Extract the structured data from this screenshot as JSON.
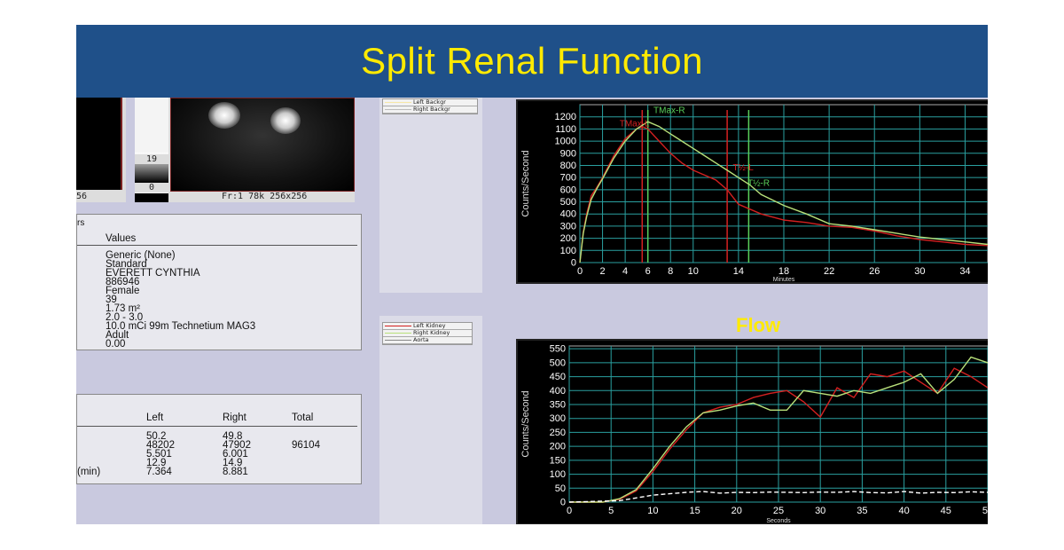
{
  "slide": {
    "title": "Split Renal Function"
  },
  "top_left": {
    "image_caption_partial": "56",
    "scale_max": "19",
    "scale_min": "0",
    "image_caption": "Fr:1 78k 256x256"
  },
  "info_panel": {
    "header_partial": "rs",
    "column_header": "Values",
    "values": [
      "Generic (None)",
      "Standard",
      "EVERETT CYNTHIA",
      "886946",
      "Female",
      "39",
      "1.73 m²",
      "2.0 - 3.0",
      "10.0 mCi 99m Technetium MAG3",
      "Adult",
      "0.00"
    ]
  },
  "results_panel": {
    "columns": [
      "Left",
      "Right",
      "Total"
    ],
    "rows": [
      {
        "label": "",
        "left": "50.2",
        "right": "49.8",
        "total": ""
      },
      {
        "label": "",
        "left": "48202",
        "right": "47902",
        "total": "96104"
      },
      {
        "label": "",
        "left": "5.501",
        "right": "6.001",
        "total": ""
      },
      {
        "label": "",
        "left": "12.9",
        "right": "14.9",
        "total": ""
      },
      {
        "label": "(min)",
        "left": "7.364",
        "right": "8.881",
        "total": ""
      }
    ]
  },
  "legend_top": {
    "items": [
      "Left Backgr",
      "Right Backgr"
    ]
  },
  "legend_bottom": {
    "items": [
      "Left Kidney",
      "Right Kidney",
      "Aorta"
    ]
  },
  "colors": {
    "left": "#d42020",
    "right": "#b8e07a",
    "aorta": "#ffffff",
    "grid": "#2aa0a0",
    "title_yellow": "#ffea00"
  },
  "chart_data": [
    {
      "type": "line",
      "title": "",
      "xlabel": "Minutes",
      "ylabel": "Counts/Second",
      "xlim": [
        0,
        36
      ],
      "ylim": [
        0,
        1300
      ],
      "xticks": [
        0,
        2,
        4,
        6,
        8,
        10,
        14,
        18,
        22,
        26,
        30,
        34
      ],
      "yticks": [
        0,
        100,
        200,
        300,
        400,
        500,
        600,
        700,
        800,
        900,
        1000,
        1100,
        1200
      ],
      "annotations": [
        "TMax-R",
        "TMax-L",
        "T½-L",
        "T½-R"
      ],
      "vlines": [
        {
          "x": 5.5,
          "series": "Left"
        },
        {
          "x": 6.0,
          "series": "Right"
        },
        {
          "x": 13.0,
          "series": "Left"
        },
        {
          "x": 14.9,
          "series": "Right"
        }
      ],
      "series": [
        {
          "name": "Left Kidney",
          "x": [
            0,
            0.3,
            0.6,
            1,
            1.5,
            2,
            3,
            4,
            5,
            5.5,
            6,
            7,
            8,
            9,
            10,
            11,
            12,
            13,
            14,
            16,
            18,
            20,
            22,
            24,
            26,
            28,
            30,
            32,
            34,
            36
          ],
          "y": [
            0,
            250,
            400,
            550,
            620,
            700,
            880,
            1020,
            1100,
            1120,
            1100,
            1000,
            900,
            820,
            760,
            720,
            680,
            600,
            480,
            400,
            350,
            330,
            300,
            290,
            260,
            220,
            190,
            170,
            150,
            140
          ]
        },
        {
          "name": "Right Kidney",
          "x": [
            0,
            0.3,
            0.6,
            1,
            1.5,
            2,
            3,
            4,
            5,
            6,
            7,
            8,
            9,
            10,
            11,
            12,
            13,
            14,
            15,
            16,
            18,
            20,
            22,
            24,
            26,
            28,
            30,
            32,
            34,
            36
          ],
          "y": [
            0,
            240,
            380,
            520,
            610,
            690,
            860,
            1000,
            1100,
            1160,
            1120,
            1060,
            1000,
            940,
            880,
            820,
            760,
            700,
            640,
            560,
            470,
            400,
            320,
            300,
            270,
            240,
            210,
            190,
            170,
            150
          ]
        }
      ]
    },
    {
      "type": "line",
      "title": "Flow",
      "xlabel": "Seconds",
      "ylabel": "Counts/Second",
      "xlim": [
        0,
        50
      ],
      "ylim": [
        0,
        560
      ],
      "xticks": [
        0,
        5,
        10,
        15,
        20,
        25,
        30,
        35,
        40,
        45,
        50
      ],
      "yticks": [
        0,
        50,
        100,
        150,
        200,
        250,
        300,
        350,
        400,
        450,
        500,
        550
      ],
      "series": [
        {
          "name": "Left Kidney",
          "x": [
            0,
            4,
            6,
            8,
            10,
            12,
            14,
            16,
            18,
            20,
            22,
            24,
            26,
            28,
            30,
            32,
            34,
            36,
            38,
            40,
            42,
            44,
            46,
            48,
            50
          ],
          "y": [
            0,
            0,
            10,
            40,
            110,
            190,
            260,
            320,
            340,
            350,
            375,
            390,
            400,
            360,
            305,
            410,
            375,
            460,
            450,
            470,
            430,
            390,
            480,
            450,
            410
          ]
        },
        {
          "name": "Right Kidney",
          "x": [
            0,
            4,
            6,
            8,
            10,
            12,
            14,
            16,
            18,
            20,
            22,
            24,
            26,
            28,
            30,
            32,
            34,
            36,
            38,
            40,
            42,
            44,
            46,
            48,
            50
          ],
          "y": [
            0,
            0,
            12,
            45,
            120,
            200,
            270,
            320,
            330,
            345,
            355,
            330,
            330,
            400,
            390,
            380,
            400,
            390,
            410,
            430,
            460,
            390,
            440,
            520,
            500
          ]
        },
        {
          "name": "Aorta",
          "x": [
            0,
            6,
            8,
            10,
            12,
            14,
            16,
            18,
            20,
            22,
            24,
            26,
            28,
            30,
            32,
            34,
            36,
            38,
            40,
            42,
            44,
            46,
            48,
            50
          ],
          "y": [
            0,
            5,
            15,
            25,
            30,
            35,
            38,
            32,
            35,
            34,
            36,
            35,
            34,
            36,
            35,
            38,
            34,
            33,
            38,
            32,
            35,
            34,
            37,
            35
          ]
        }
      ]
    }
  ]
}
